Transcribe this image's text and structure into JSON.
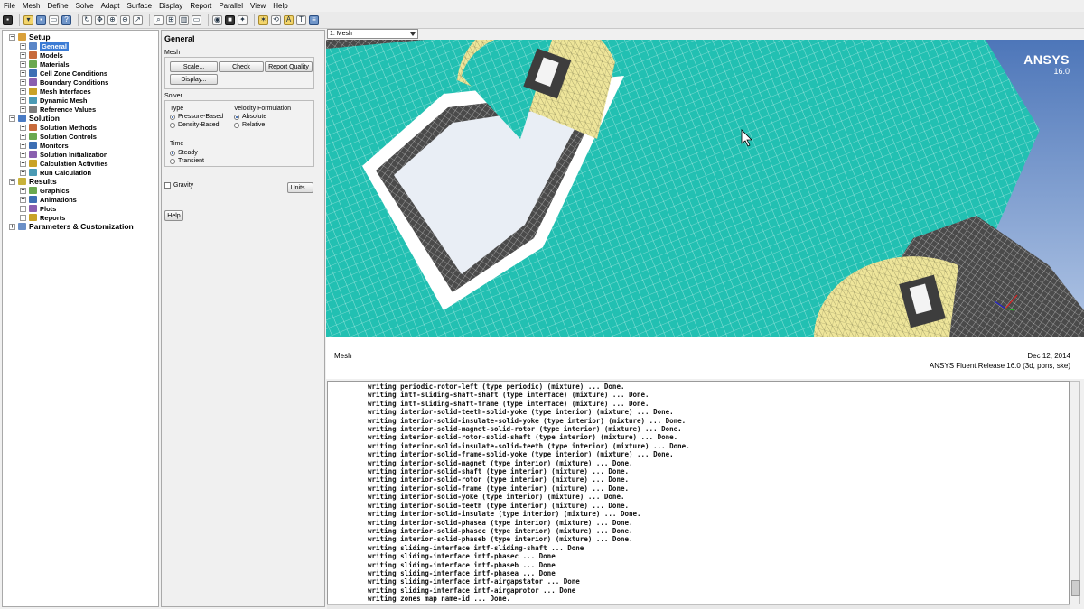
{
  "menu": [
    "File",
    "Mesh",
    "Define",
    "Solve",
    "Adapt",
    "Surface",
    "Display",
    "Report",
    "Parallel",
    "View",
    "Help"
  ],
  "tree": {
    "sections": [
      {
        "label": "Setup",
        "items": [
          "General",
          "Models",
          "Materials",
          "Cell Zone Conditions",
          "Boundary Conditions",
          "Mesh Interfaces",
          "Dynamic Mesh",
          "Reference Values"
        ]
      },
      {
        "label": "Solution",
        "items": [
          "Solution Methods",
          "Solution Controls",
          "Monitors",
          "Solution Initialization",
          "Calculation Activities",
          "Run Calculation"
        ]
      },
      {
        "label": "Results",
        "items": [
          "Graphics",
          "Animations",
          "Plots",
          "Reports"
        ]
      },
      {
        "label": "Parameters & Customization",
        "items": []
      }
    ],
    "selected": "General"
  },
  "task": {
    "title": "General",
    "mesh_label": "Mesh",
    "scale_btn": "Scale...",
    "check_btn": "Check",
    "report_quality_btn": "Report Quality",
    "display_btn": "Display...",
    "solver_label": "Solver",
    "type_label": "Type",
    "pressure_based": "Pressure-Based",
    "density_based": "Density-Based",
    "velocity_label": "Velocity Formulation",
    "absolute": "Absolute",
    "relative": "Relative",
    "time_label": "Time",
    "steady": "Steady",
    "transient": "Transient",
    "gravity": "Gravity",
    "units_btn": "Units...",
    "help_btn": "Help"
  },
  "graphics": {
    "window_select": "1: Mesh",
    "logo_name": "ANSYS",
    "logo_version": "16.0",
    "caption": "Mesh",
    "date": "Dec 12, 2014",
    "release": "ANSYS Fluent Release 16.0 (3d, pbns, ske)",
    "colors": {
      "mesh_cyan": "#22c0b2",
      "mesh_yellow": "#eee59a",
      "mesh_dark": "#4a4a4a",
      "bg_top": "#4d76b9",
      "bg_bottom": "#b3c7e6"
    }
  },
  "console": {
    "lines": [
      "writing periodic-rotor-left (type periodic) (mixture) ... Done.",
      "writing intf-sliding-shaft-shaft (type interface) (mixture) ... Done.",
      "writing intf-sliding-shaft-frame (type interface) (mixture) ... Done.",
      "writing interior-solid-teeth-solid-yoke (type interior) (mixture) ... Done.",
      "writing interior-solid-insulate-solid-yoke (type interior) (mixture) ... Done.",
      "writing interior-solid-magnet-solid-rotor (type interior) (mixture) ... Done.",
      "writing interior-solid-rotor-solid-shaft (type interior) (mixture) ... Done.",
      "writing interior-solid-insulate-solid-teeth (type interior) (mixture) ... Done.",
      "writing interior-solid-frame-solid-yoke (type interior) (mixture) ... Done.",
      "writing interior-solid-magnet (type interior) (mixture) ... Done.",
      "writing interior-solid-shaft (type interior) (mixture) ... Done.",
      "writing interior-solid-rotor (type interior) (mixture) ... Done.",
      "writing interior-solid-frame (type interior) (mixture) ... Done.",
      "writing interior-solid-yoke (type interior) (mixture) ... Done.",
      "writing interior-solid-teeth (type interior) (mixture) ... Done.",
      "writing interior-solid-insulate (type interior) (mixture) ... Done.",
      "writing interior-solid-phasea (type interior) (mixture) ... Done.",
      "writing interior-solid-phasec (type interior) (mixture) ... Done.",
      "writing interior-solid-phaseb (type interior) (mixture) ... Done.",
      "writing sliding-interface intf-sliding-shaft ... Done",
      "writing sliding-interface intf-phasec ... Done",
      "writing sliding-interface intf-phaseb ... Done",
      "writing sliding-interface intf-phasea ... Done",
      "writing sliding-interface intf-airgapstator ... Done",
      "writing sliding-interface intf-airgaprotor ... Done",
      "writing zones map name-id ... Done."
    ]
  }
}
